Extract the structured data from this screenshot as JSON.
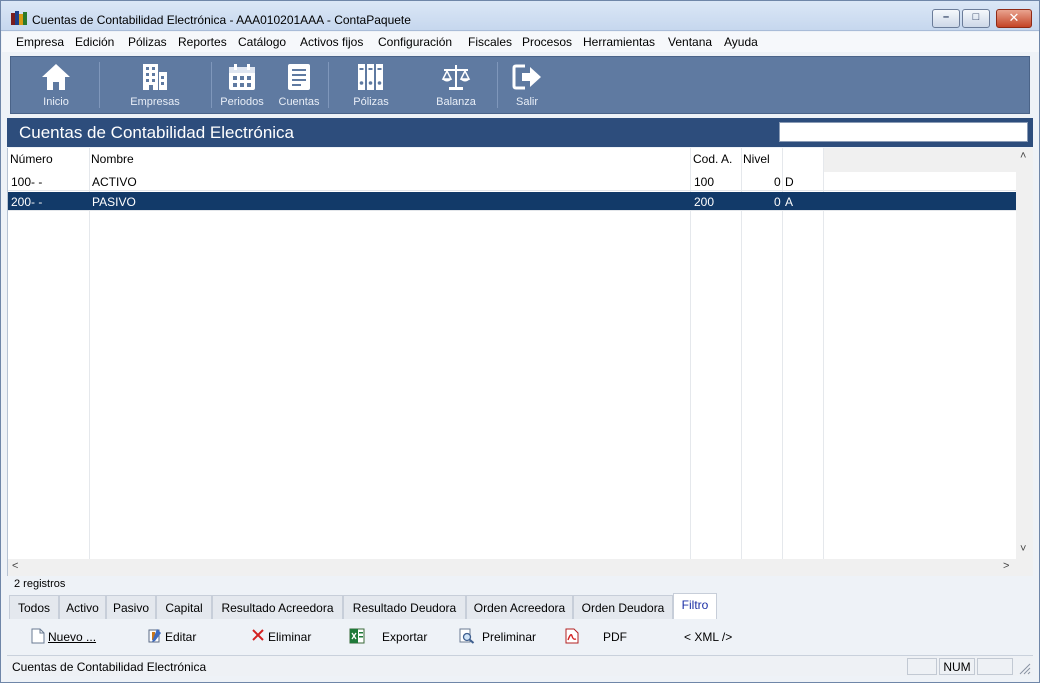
{
  "window": {
    "title": "Cuentas de Contabilidad Electrónica - AAA010201AAA - ContaPaquete",
    "minimize": "–",
    "maximize": "□",
    "close": "✕"
  },
  "menu": [
    "Empresa",
    "Edición",
    "Pólizas",
    "Reportes",
    "Catálogo",
    "Activos fijos",
    "Configuración",
    "Fiscales",
    "Procesos",
    "Herramientas",
    "Ventana",
    "Ayuda"
  ],
  "toolbar": {
    "items": [
      {
        "label": "Inicio",
        "icon": "home-icon"
      },
      {
        "label": "Empresas",
        "icon": "building-icon"
      },
      {
        "label": "Periodos",
        "icon": "calendar-icon"
      },
      {
        "label": "Cuentas",
        "icon": "ledger-icon"
      },
      {
        "label": "Pólizas",
        "icon": "binders-icon"
      },
      {
        "label": "Balanza",
        "icon": "scale-icon"
      },
      {
        "label": "Salir",
        "icon": "exit-icon"
      }
    ]
  },
  "section": {
    "title": "Cuentas de Contabilidad Electrónica",
    "search_value": ""
  },
  "grid": {
    "columns": [
      "Número",
      "Nombre",
      "Cod. A.",
      "Nivel",
      ""
    ],
    "rows": [
      {
        "numero": "100-  -",
        "nombre": "ACTIVO",
        "cod": "100",
        "nivel": "0",
        "tipo": "D",
        "selected": false
      },
      {
        "numero": "200-  -",
        "nombre": "PASIVO",
        "cod": "200",
        "nivel": "0",
        "tipo": "A",
        "selected": true
      }
    ],
    "record_count": "2 registros"
  },
  "tabs": [
    {
      "label": "Todos",
      "active": false
    },
    {
      "label": "Activo",
      "active": false
    },
    {
      "label": "Pasivo",
      "active": false
    },
    {
      "label": "Capital",
      "active": false
    },
    {
      "label": "Resultado Acreedora",
      "active": false
    },
    {
      "label": "Resultado Deudora",
      "active": false
    },
    {
      "label": "Orden Acreedora",
      "active": false
    },
    {
      "label": "Orden Deudora",
      "active": false
    },
    {
      "label": "Filtro",
      "active": true
    }
  ],
  "actions": [
    {
      "label": "Nuevo ...",
      "icon": "new-document-icon"
    },
    {
      "label": "Editar",
      "icon": "edit-icon"
    },
    {
      "label": "Eliminar",
      "icon": "delete-icon"
    },
    {
      "label": "Exportar",
      "icon": "excel-icon"
    },
    {
      "label": "Preliminar",
      "icon": "preview-icon"
    },
    {
      "label": "PDF",
      "icon": "pdf-icon"
    },
    {
      "label": "< XML />",
      "icon": ""
    }
  ],
  "status": {
    "text": "Cuentas de Contabilidad Electrónica",
    "num": "NUM"
  },
  "colors": {
    "toolbar_bg": "#5f7aa1",
    "header_bg": "#2d4d7c",
    "selected_row": "#123a69",
    "active_tab_text": "#1b2fa5"
  }
}
